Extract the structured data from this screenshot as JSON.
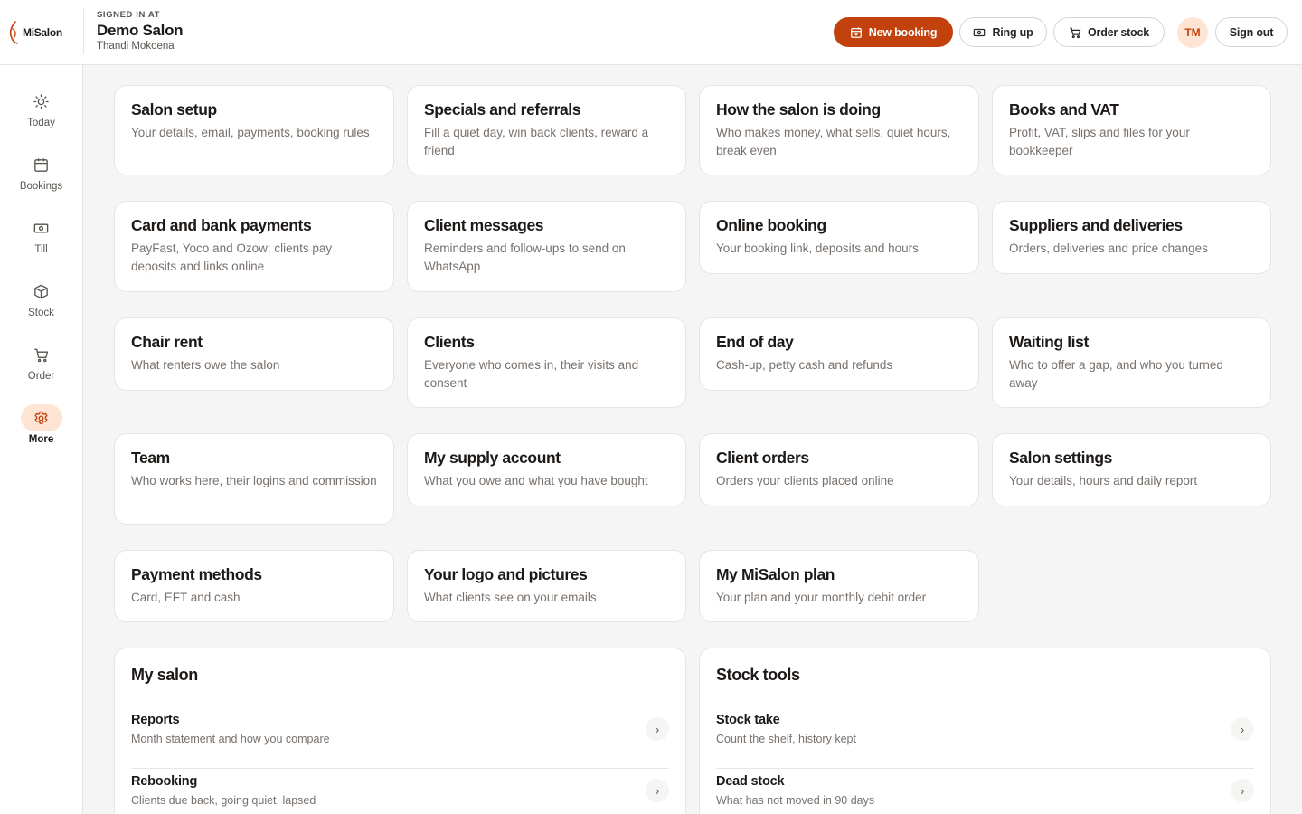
{
  "app": {
    "name": "MiSalon",
    "brand_color": "#c2410c",
    "accent_soft": "#fde4d3"
  },
  "header": {
    "signed_in_label": "SIGNED IN AT",
    "salon_name": "Demo Salon",
    "user_name": "Thandi Mokoena",
    "buttons": {
      "new_booking": {
        "label": "New booking",
        "icon": "calendar-plus-icon"
      },
      "ring_up": {
        "label": "Ring up",
        "icon": "cash-icon"
      },
      "order_stock": {
        "label": "Order stock",
        "icon": "cart-icon"
      },
      "sign_out": {
        "label": "Sign out"
      }
    },
    "avatar_initials": "TM"
  },
  "sidebar": {
    "items": [
      {
        "label": "Today",
        "icon": "sun-icon",
        "active": false
      },
      {
        "label": "Bookings",
        "icon": "calendar-icon",
        "active": false
      },
      {
        "label": "Till",
        "icon": "cash-icon",
        "active": false
      },
      {
        "label": "Stock",
        "icon": "box-icon",
        "active": false
      },
      {
        "label": "Order",
        "icon": "cart-icon",
        "active": false
      },
      {
        "label": "More",
        "icon": "gear-icon",
        "active": true
      }
    ]
  },
  "cards": [
    {
      "title": "Salon setup",
      "desc": "Your details, email, payments, booking rules"
    },
    {
      "title": "Specials and referrals",
      "desc": "Fill a quiet day, win back clients, reward a friend"
    },
    {
      "title": "How the salon is doing",
      "desc": "Who makes money, what sells, quiet hours, break even"
    },
    {
      "title": "Books and VAT",
      "desc": "Profit, VAT, slips and files for your bookkeeper"
    },
    {
      "title": "Card and bank payments",
      "desc": "PayFast, Yoco and Ozow: clients pay deposits and links online"
    },
    {
      "title": "Client messages",
      "desc": "Reminders and follow-ups to send on WhatsApp"
    },
    {
      "title": "Online booking",
      "desc": "Your booking link, deposits and hours"
    },
    {
      "title": "Suppliers and deliveries",
      "desc": "Orders, deliveries and price changes"
    },
    {
      "title": "Chair rent",
      "desc": "What renters owe the salon"
    },
    {
      "title": "Clients",
      "desc": "Everyone who comes in, their visits and consent"
    },
    {
      "title": "End of day",
      "desc": "Cash-up, petty cash and refunds"
    },
    {
      "title": "Waiting list",
      "desc": "Who to offer a gap, and who you turned away"
    },
    {
      "title": "Team",
      "desc": "Who works here, their logins and commission"
    },
    {
      "title": "My supply account",
      "desc": "What you owe and what you have bought"
    },
    {
      "title": "Client orders",
      "desc": "Orders your clients placed online"
    },
    {
      "title": "Salon settings",
      "desc": "Your details, hours and daily report"
    },
    {
      "title": "Payment methods",
      "desc": "Card, EFT and cash"
    },
    {
      "title": "Your logo and pictures",
      "desc": "What clients see on your emails"
    },
    {
      "title": "My MiSalon plan",
      "desc": "Your plan and your monthly debit order"
    }
  ],
  "panels": [
    {
      "title": "My salon",
      "rows": [
        {
          "title": "Reports",
          "desc": "Month statement and how you compare"
        },
        {
          "title": "Rebooking",
          "desc": "Clients due back, going quiet, lapsed"
        }
      ]
    },
    {
      "title": "Stock tools",
      "rows": [
        {
          "title": "Stock take",
          "desc": "Count the shelf, history kept"
        },
        {
          "title": "Dead stock",
          "desc": "What has not moved in 90 days"
        }
      ]
    }
  ]
}
